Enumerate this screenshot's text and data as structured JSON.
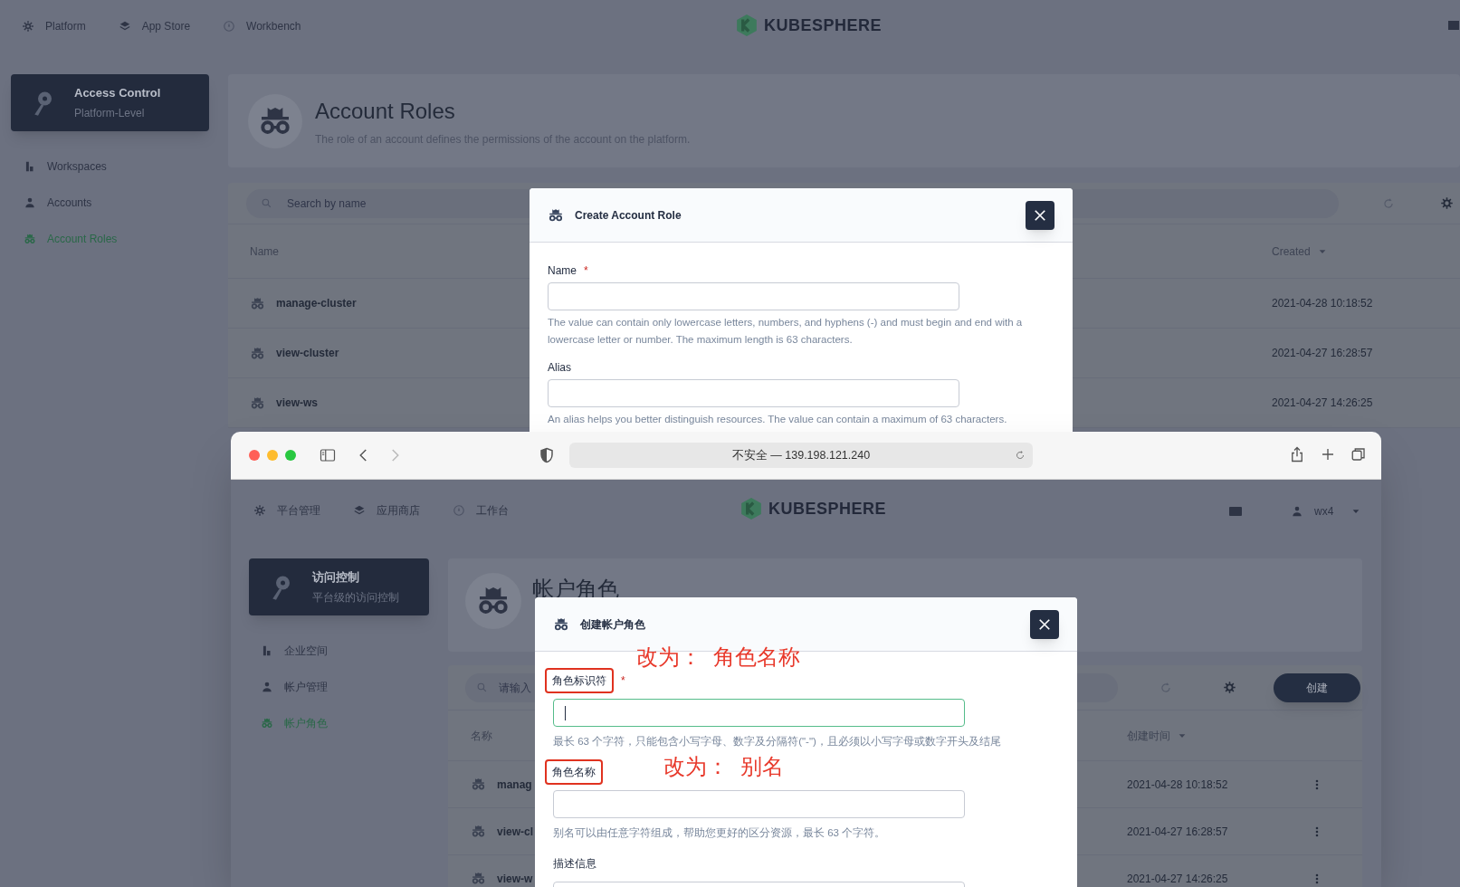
{
  "background_page": {
    "nav": [
      {
        "label": "Platform"
      },
      {
        "label": "App Store"
      },
      {
        "label": "Workbench"
      }
    ],
    "logo_text": "KUBESPHERE",
    "sidebar": {
      "title": "Access Control",
      "subtitle": "Platform-Level",
      "items": [
        {
          "label": "Workspaces",
          "selected": false
        },
        {
          "label": "Accounts",
          "selected": false
        },
        {
          "label": "Account Roles",
          "selected": true
        }
      ]
    },
    "header": {
      "title": "Account Roles",
      "description": "The role of an account defines the permissions of the account on the platform."
    },
    "search": {
      "placeholder": "Search by name"
    },
    "table": {
      "columns": [
        "Name",
        "Created"
      ],
      "rows": [
        {
          "name": "manage-cluster",
          "created": "2021-04-28 10:18:52"
        },
        {
          "name": "view-cluster",
          "created": "2021-04-27 16:28:57"
        },
        {
          "name": "view-ws",
          "created": "2021-04-27 14:26:25"
        }
      ]
    },
    "dialog": {
      "title": "Create Account Role",
      "fields": [
        {
          "label": "Name",
          "required_mark": "*",
          "hint": "The value can contain only lowercase letters, numbers, and hyphens (-) and must begin and end with a lowercase letter or number. The maximum length is 63 characters."
        },
        {
          "label": "Alias",
          "hint": "An alias helps you better distinguish resources. The value can contain a maximum of 63 characters."
        }
      ]
    }
  },
  "browser": {
    "url": "不安全 — 139.198.121.240",
    "page": {
      "nav": [
        {
          "label": "平台管理"
        },
        {
          "label": "应用商店"
        },
        {
          "label": "工作台"
        }
      ],
      "logo_text": "KUBESPHERE",
      "user": "wx4",
      "sidebar": {
        "title": "访问控制",
        "subtitle": "平台级的访问控制",
        "items": [
          {
            "label": "企业空间",
            "selected": false
          },
          {
            "label": "帐户管理",
            "selected": false
          },
          {
            "label": "帐户角色",
            "selected": true
          }
        ]
      },
      "header": {
        "title": "帐户角色"
      },
      "search": {
        "placeholder": "请输入"
      },
      "create_button": "创建",
      "table": {
        "columns": [
          "名称",
          "创建时间"
        ],
        "rows": [
          {
            "name": "manag",
            "created": "2021-04-28 10:18:52"
          },
          {
            "name": "view-cl",
            "created": "2021-04-27 16:28:57"
          },
          {
            "name": "view-w",
            "created": "2021-04-27 14:26:25"
          }
        ]
      },
      "dialog": {
        "title": "创建帐户角色",
        "fields": [
          {
            "label": "角色标识符",
            "required_mark": "*",
            "focused": true,
            "highlighted": true,
            "annotation": "改为：  角色名称",
            "hint": "最长 63 个字符，只能包含小写字母、数字及分隔符(\"-\")，且必须以小写字母或数字开头及结尾"
          },
          {
            "label": "角色名称",
            "focused": false,
            "highlighted": true,
            "annotation": "改为：  别名",
            "hint": "别名可以由任意字符组成，帮助您更好的区分资源，最长 63 个字符。"
          },
          {
            "label": "描述信息",
            "focused": false,
            "highlighted": false
          }
        ]
      }
    }
  }
}
